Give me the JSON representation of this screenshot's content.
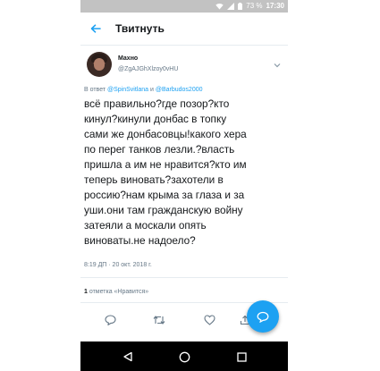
{
  "status_bar": {
    "battery": "73 %",
    "time": "17:30"
  },
  "app_bar": {
    "title": "Твитнуть"
  },
  "tweet": {
    "name": "Махно",
    "handle": "@ZgAJGhXlzoy0vHU",
    "reply_prefix": "В ответ ",
    "reply_user_1": "@SpinSvitlana",
    "reply_conj": " и ",
    "reply_user_2": "@Barbudos2000",
    "text": "всё правильно?где позор?кто\nкинул?кинули донбас в топку\nсами же донбасовцы!какого хера\nпо перег танков лезли.?власть\nпришла а им не нравится?кто им\nтеперь виновать?захотели в\nроссию?нам крыма за глаза и за\nуши.они там гражданскую войну\nзатеяли а москали опять\nвиноваты.не надоело?",
    "timestamp": "8:19 ДП · 20 окт. 2018 г.",
    "likes_count": "1",
    "likes_label": " отметка «Нравится»"
  },
  "icons": {
    "back": "arrow-left-icon",
    "menu": "chevron-down-icon",
    "reply": "reply-icon",
    "retweet": "retweet-icon",
    "like": "heart-icon",
    "share": "share-icon",
    "fab": "compose-reply-icon",
    "nav_back": "triangle-back-icon",
    "nav_home": "circle-home-icon",
    "nav_recents": "square-recents-icon"
  },
  "colors": {
    "accent": "#1da1f2",
    "secondary_text": "#657786",
    "status_bar": "#c2c2c2",
    "nav_bar": "#000000"
  }
}
